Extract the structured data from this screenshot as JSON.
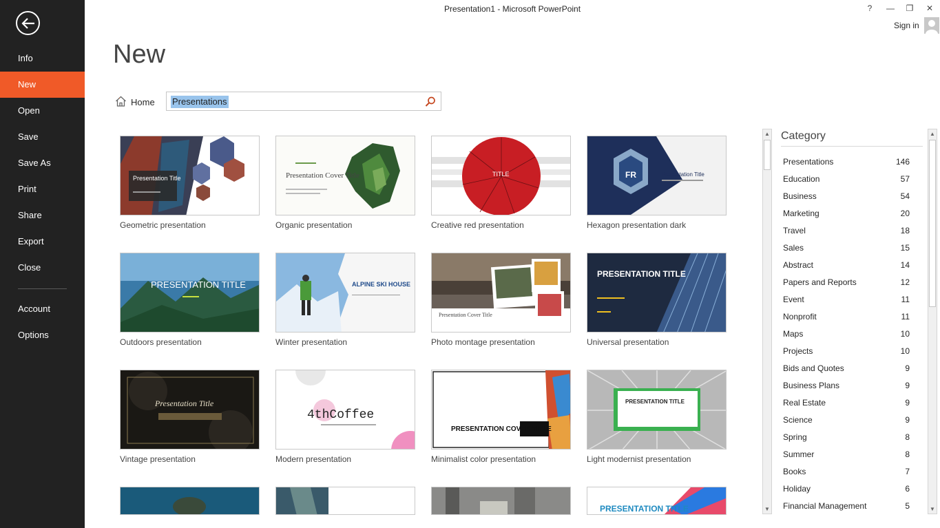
{
  "window": {
    "title": "Presentation1 - Microsoft PowerPoint",
    "help_glyph": "?",
    "minimize_glyph": "—",
    "restore_glyph": "❐",
    "close_glyph": "✕",
    "sign_in": "Sign in"
  },
  "nav": {
    "items": [
      {
        "label": "Info"
      },
      {
        "label": "New",
        "active": true
      },
      {
        "label": "Open"
      },
      {
        "label": "Save"
      },
      {
        "label": "Save As"
      },
      {
        "label": "Print"
      },
      {
        "label": "Share"
      },
      {
        "label": "Export"
      },
      {
        "label": "Close"
      },
      {
        "label": "Account"
      },
      {
        "label": "Options"
      }
    ],
    "accent_color": "#f05a28"
  },
  "page": {
    "title": "New",
    "home_label": "Home",
    "search_value": "Presentations"
  },
  "templates": [
    {
      "label": "Geometric presentation",
      "thumb_text": "Presentation Title"
    },
    {
      "label": "Organic presentation",
      "thumb_text": "Presentation Cover Title"
    },
    {
      "label": "Creative red presentation",
      "thumb_text": "TITLE"
    },
    {
      "label": "Hexagon presentation dark",
      "thumb_text": "Presentation Title"
    },
    {
      "label": "Outdoors presentation",
      "thumb_text": "PRESENTATION TITLE"
    },
    {
      "label": "Winter presentation",
      "thumb_text": "ALPINE SKI HOUSE"
    },
    {
      "label": "Photo montage presentation",
      "thumb_text": "Presentation Cover Title"
    },
    {
      "label": "Universal presentation",
      "thumb_text": "PRESENTATION TITLE"
    },
    {
      "label": "Vintage presentation",
      "thumb_text": "Presentation Title"
    },
    {
      "label": "Modern presentation",
      "thumb_text": "4thCoffee"
    },
    {
      "label": "Minimalist color presentation",
      "thumb_text": "PRESENTATION COVER TITLE"
    },
    {
      "label": "Light modernist presentation",
      "thumb_text": "PRESENTATION TITLE"
    },
    {
      "label": "",
      "thumb_text": ""
    },
    {
      "label": "",
      "thumb_text": ""
    },
    {
      "label": "",
      "thumb_text": ""
    },
    {
      "label": "",
      "thumb_text": "PRESENTATION TITLE"
    }
  ],
  "category": {
    "title": "Category",
    "items": [
      {
        "name": "Presentations",
        "count": "146"
      },
      {
        "name": "Education",
        "count": "57"
      },
      {
        "name": "Business",
        "count": "54"
      },
      {
        "name": "Marketing",
        "count": "20"
      },
      {
        "name": "Travel",
        "count": "18"
      },
      {
        "name": "Sales",
        "count": "15"
      },
      {
        "name": "Abstract",
        "count": "14"
      },
      {
        "name": "Papers and Reports",
        "count": "12"
      },
      {
        "name": "Event",
        "count": "11"
      },
      {
        "name": "Nonprofit",
        "count": "11"
      },
      {
        "name": "Maps",
        "count": "10"
      },
      {
        "name": "Projects",
        "count": "10"
      },
      {
        "name": "Bids and Quotes",
        "count": "9"
      },
      {
        "name": "Business Plans",
        "count": "9"
      },
      {
        "name": "Real Estate",
        "count": "9"
      },
      {
        "name": "Science",
        "count": "9"
      },
      {
        "name": "Spring",
        "count": "8"
      },
      {
        "name": "Summer",
        "count": "8"
      },
      {
        "name": "Books",
        "count": "7"
      },
      {
        "name": "Holiday",
        "count": "6"
      },
      {
        "name": "Financial Management",
        "count": "5"
      }
    ]
  }
}
